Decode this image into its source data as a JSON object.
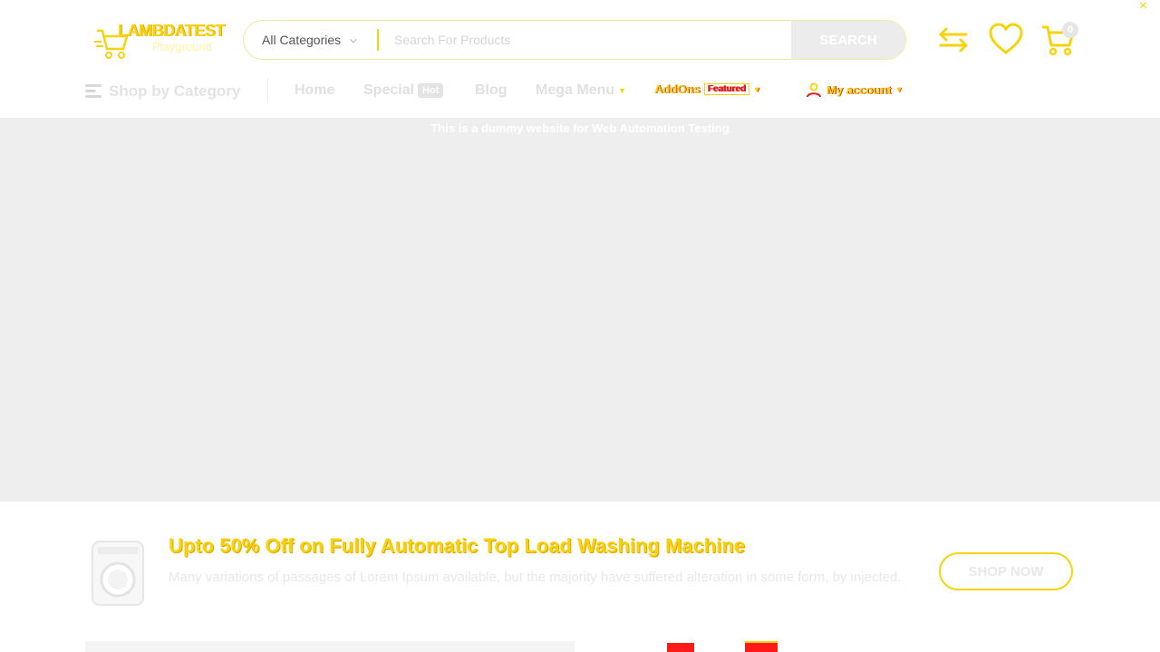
{
  "header": {
    "close_glyph": "×",
    "logo": {
      "title": "LAMBDATEST",
      "subtitle": "Playground"
    },
    "search": {
      "category": "All Categories",
      "placeholder": "Search For Products",
      "button": "SEARCH"
    },
    "cart_count": "0",
    "icons": [
      "compare-icon",
      "heart-icon",
      "cart-icon"
    ]
  },
  "nav": {
    "shop_by_category": "Shop by Category",
    "items": {
      "home": "Home",
      "special": "Special",
      "special_badge": "Hot",
      "blog": "Blog",
      "mega_menu": "Mega Menu",
      "addons": "AddOns",
      "addons_badge": "Featured",
      "my_account": "My account"
    }
  },
  "banner": {
    "text": "This is a dummy website for Web Automation Testing"
  },
  "promo": {
    "title": "Upto 50% Off on Fully Automatic Top Load Washing Machine",
    "description": "Many variations of passages of Lorem Ipsum available, but the majority have suffered alteration in some form, by injected.",
    "button": "SHOP NOW"
  },
  "colors": {
    "accent": "#f5d40f",
    "banner_bg": "#eeeeee",
    "alert_red": "#ff1a1a"
  }
}
